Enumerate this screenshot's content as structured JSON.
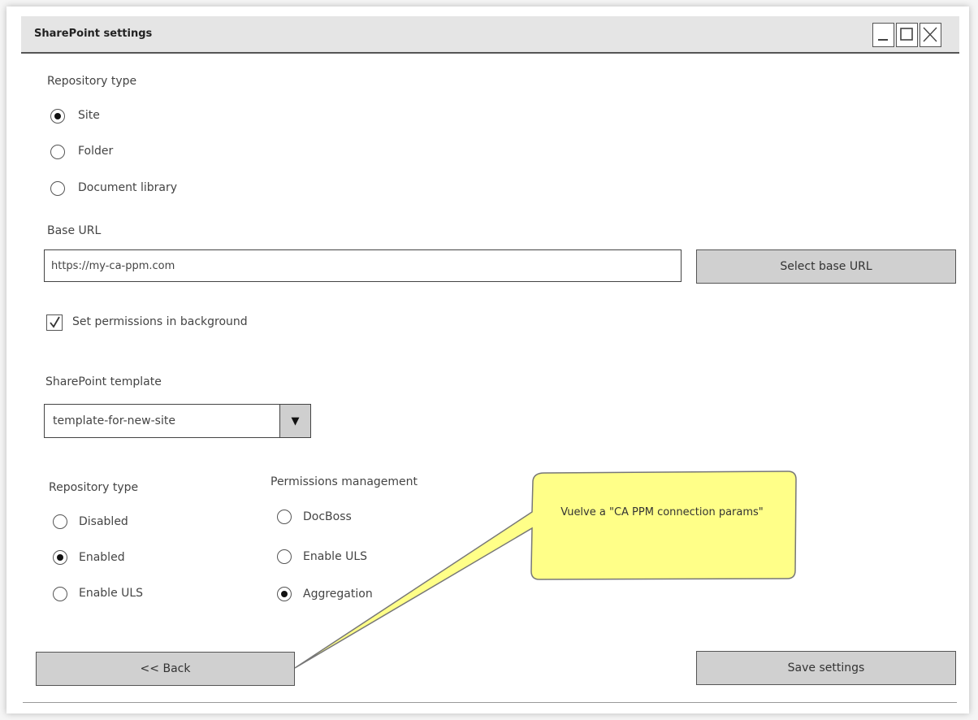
{
  "window": {
    "title": "SharePoint settings",
    "controls": {
      "minimize_icon": "minimize-icon",
      "maximize_icon": "maximize-icon",
      "close_icon": "close-icon"
    }
  },
  "repository": {
    "label": "Repository type",
    "options": [
      {
        "label": "Site",
        "selected": true
      },
      {
        "label": "Folder",
        "selected": false
      },
      {
        "label": "Document library",
        "selected": false
      }
    ]
  },
  "base_url": {
    "label": "Base URL",
    "value": "https://my-ca-ppm.com",
    "button_label": "Select base URL"
  },
  "permissions_background": {
    "label": "Set permissions in background",
    "checked": true
  },
  "template": {
    "label": "SharePoint template",
    "selected": "template-for-new-site"
  },
  "repository_state": {
    "label": "Repository type",
    "options": [
      {
        "label": "Disabled",
        "selected": false
      },
      {
        "label": "Enabled",
        "selected": true
      },
      {
        "label": "Enable ULS",
        "selected": false
      }
    ]
  },
  "permissions_management": {
    "label": "Permissions management",
    "options": [
      {
        "label": "DocBoss",
        "selected": false
      },
      {
        "label": "Enable ULS",
        "selected": false
      },
      {
        "label": "Aggregation",
        "selected": true
      }
    ]
  },
  "callout": {
    "text": "Vuelve a \"CA PPM connection params\"",
    "fill": "#ffff88"
  },
  "footer": {
    "back_label": "<< Back",
    "save_label": "Save settings"
  }
}
